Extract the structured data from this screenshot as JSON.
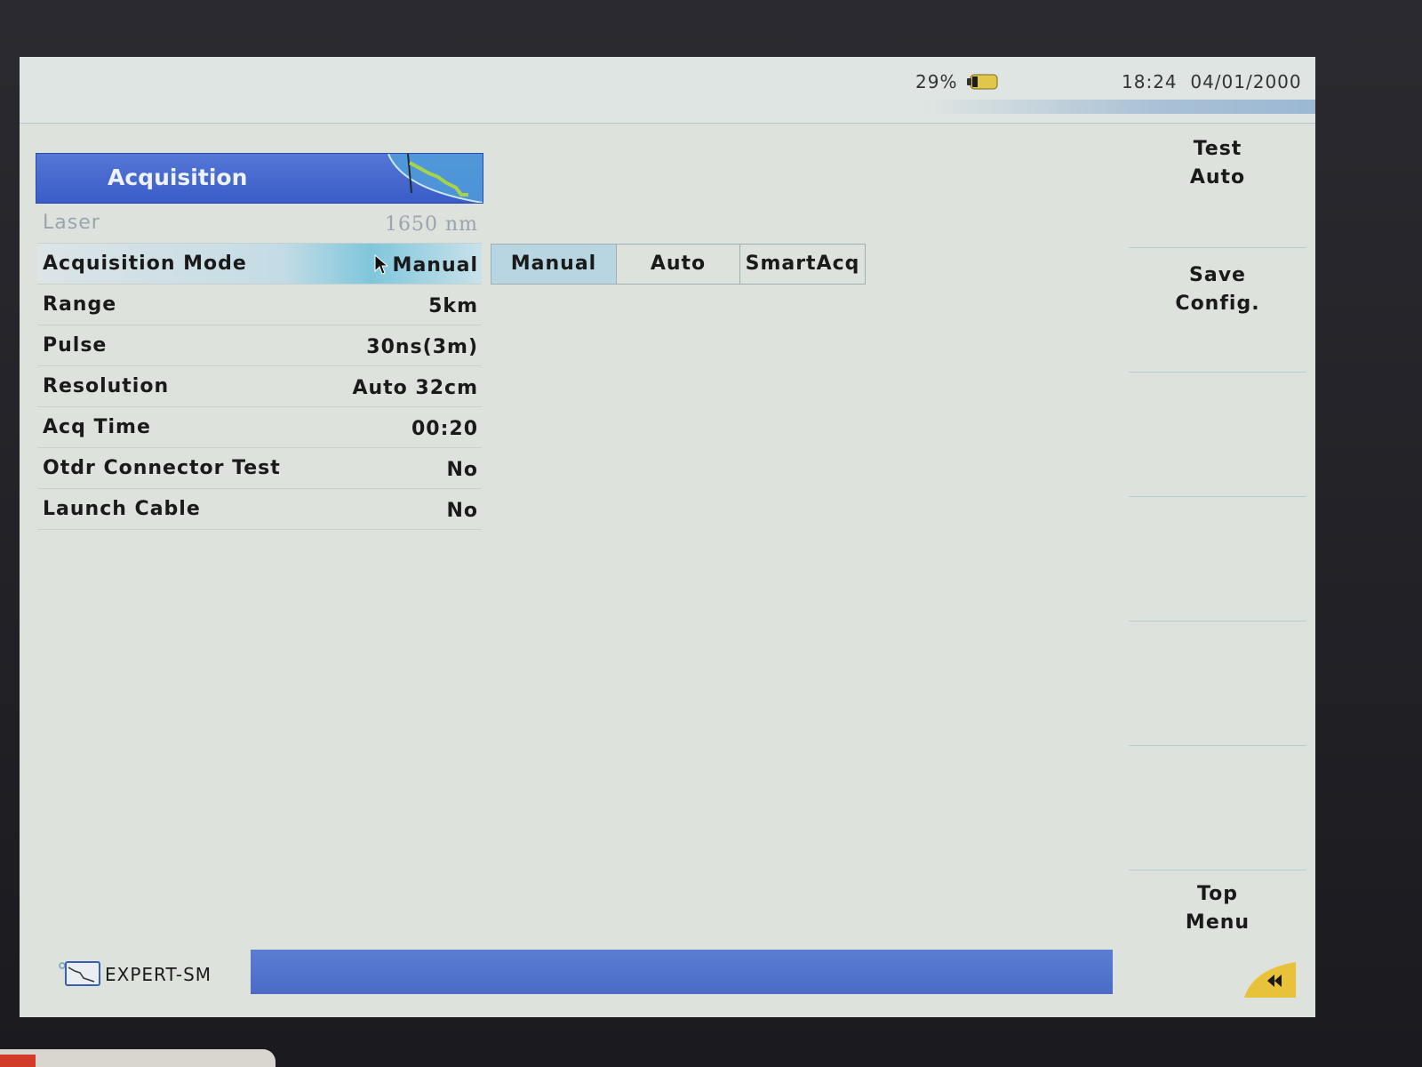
{
  "status": {
    "battery_percent": "29%",
    "time": "18:24",
    "date": "04/01/2000"
  },
  "panel": {
    "title": "Acquisition",
    "rows": [
      {
        "label": "Laser",
        "value": "1650 nm"
      },
      {
        "label": "Acquisition Mode",
        "value": "Manual"
      },
      {
        "label": "Range",
        "value": "5km"
      },
      {
        "label": "Pulse",
        "value": "30ns(3m)"
      },
      {
        "label": "Resolution",
        "value": "Auto 32cm"
      },
      {
        "label": "Acq Time",
        "value": "00:20"
      },
      {
        "label": "Otdr Connector Test",
        "value": "No"
      },
      {
        "label": "Launch Cable",
        "value": "No"
      }
    ]
  },
  "options": [
    "Manual",
    "Auto",
    "SmartAcq"
  ],
  "softkeys": {
    "test_auto": {
      "line1": "Test",
      "line2": "Auto"
    },
    "save_config": {
      "line1": "Save",
      "line2": "Config."
    },
    "top_menu": {
      "line1": "Top",
      "line2": "Menu"
    }
  },
  "footer": {
    "module_label": "EXPERT-SM"
  },
  "colors": {
    "header_blue": "#3a5cc8",
    "selection_cyan": "#7fc6dc",
    "screen_bg": "#dde2dc"
  },
  "icons": {
    "panel": "otdr-trace-icon",
    "battery": "battery-icon",
    "cursor": "pointer-cursor-icon",
    "module": "otdr-module-icon",
    "back": "rewind-icon"
  }
}
